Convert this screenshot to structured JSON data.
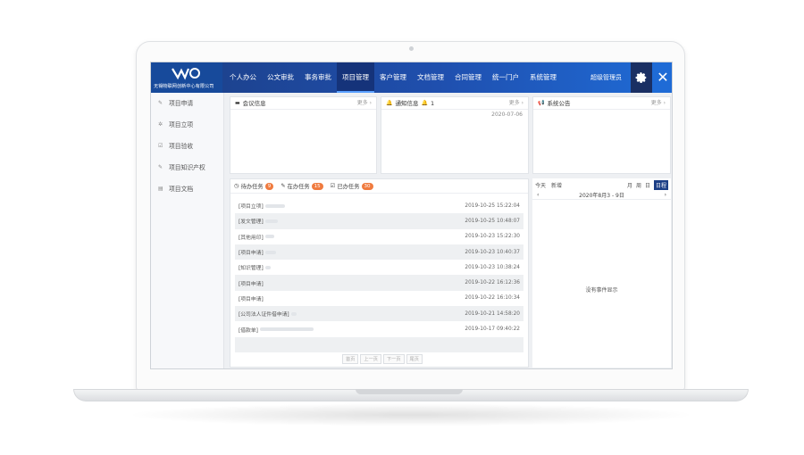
{
  "company": "无锡物联网创新中心有限公司",
  "nav": [
    "个人办公",
    "公文审批",
    "事务审批",
    "项目管理",
    "客户管理",
    "文档管理",
    "合同管理",
    "统一门户",
    "系统管理"
  ],
  "admin_user": "超级管理员",
  "sidebar": [
    "项目申请",
    "项目立项",
    "项目验收",
    "项目知识产权",
    "项目文档"
  ],
  "panels": {
    "meeting": {
      "title": "会议信息",
      "more": "更多 ›"
    },
    "notice": {
      "title": "通知信息",
      "count": "1",
      "more": "更多 ›",
      "date": "2020-07-06"
    },
    "announce": {
      "title": "系统公告",
      "more": "更多 ›"
    }
  },
  "tasks": {
    "tabs": [
      {
        "label": "待办任务",
        "count": "9"
      },
      {
        "label": "在办任务",
        "count": "15"
      },
      {
        "label": "已办任务",
        "count": "30"
      }
    ],
    "rows": [
      {
        "label": "[项目立项]",
        "time": "2019-10-25 15:22:04"
      },
      {
        "label": "[发文管理]",
        "time": "2019-10-25 10:48:07"
      },
      {
        "label": "[其他用印]",
        "time": "2019-10-23 15:22:30"
      },
      {
        "label": "[项目申请]",
        "time": "2019-10-23 10:40:37"
      },
      {
        "label": "[知识管理]",
        "time": "2019-10-23 10:38:24"
      },
      {
        "label": "[项目申请]",
        "time": "2019-10-22 16:12:36"
      },
      {
        "label": "[项目申请]",
        "time": "2019-10-22 16:10:34"
      },
      {
        "label": "[公司法人证件借申请]",
        "time": "2019-10-21 14:58:20"
      },
      {
        "label": "[借款单]",
        "time": "2019-10-17 09:40:22"
      }
    ],
    "pager": [
      "首页",
      "上一页",
      "下一页",
      "尾页"
    ]
  },
  "calendar": {
    "today": "今天",
    "new": "新增",
    "views": [
      "月",
      "周",
      "日",
      "日程"
    ],
    "range": "2020年8月3 - 9日",
    "empty": "没有事件显示"
  }
}
